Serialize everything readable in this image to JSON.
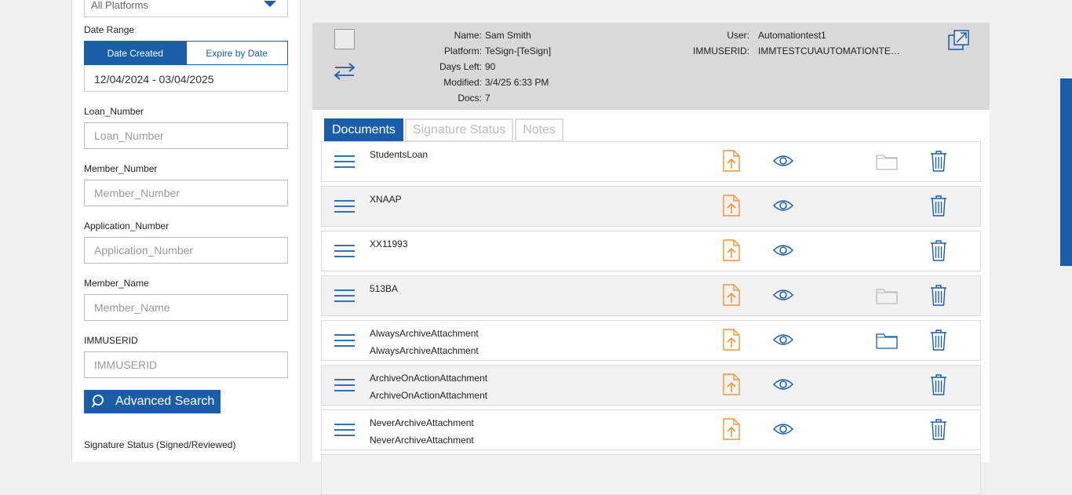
{
  "filters": {
    "platform_value": "All Platforms",
    "date_range_label": "Date Range",
    "toggle_created": "Date Created",
    "toggle_expire": "Expire by Date",
    "date_range_value": "12/04/2024 - 03/04/2025",
    "loan_label": "Loan_Number",
    "loan_placeholder": "Loan_Number",
    "member_number_label": "Member_Number",
    "member_number_placeholder": "Member_Number",
    "application_label": "Application_Number",
    "application_placeholder": "Application_Number",
    "member_name_label": "Member_Name",
    "member_name_placeholder": "Member_Name",
    "immuserid_label": "IMMUSERID",
    "immuserid_placeholder": "IMMUSERID",
    "advanced_search": "Advanced Search",
    "signature_status_label": "Signature Status (Signed/Reviewed)"
  },
  "info": {
    "name_label": "Name:",
    "name_value": "Sam Smith",
    "platform_label": "Platform:",
    "platform_value": "TeSign-[TeSign]",
    "days_left_label": "Days Left:",
    "days_left_value": "90",
    "modified_label": "Modified:",
    "modified_value": "3/4/25 6:33 PM",
    "docs_label": "Docs:",
    "docs_value": "7",
    "user_label": "User:",
    "user_value": "Automationtest1",
    "immuserid_label": "IMMUSERID:",
    "immuserid_value": "IMMTESTCU\\AUTOMATIONTE…"
  },
  "tabs": [
    "Documents",
    "Signature Status",
    "Notes"
  ],
  "documents": [
    {
      "line1": "StudentsLoan",
      "line2": ""
    },
    {
      "line1": "XNAAP",
      "line2": ""
    },
    {
      "line1": "XX11993",
      "line2": ""
    },
    {
      "line1": "513BA",
      "line2": ""
    },
    {
      "line1": "AlwaysArchiveAttachment",
      "line2": "AlwaysArchiveAttachment"
    },
    {
      "line1": "ArchiveOnActionAttachment",
      "line2": "ArchiveOnActionAttachment"
    },
    {
      "line1": "NeverArchiveAttachment",
      "line2": "NeverArchiveAttachment"
    }
  ],
  "colors": {
    "accent": "#1a5ea8",
    "upload_orange": "#f0953a"
  }
}
